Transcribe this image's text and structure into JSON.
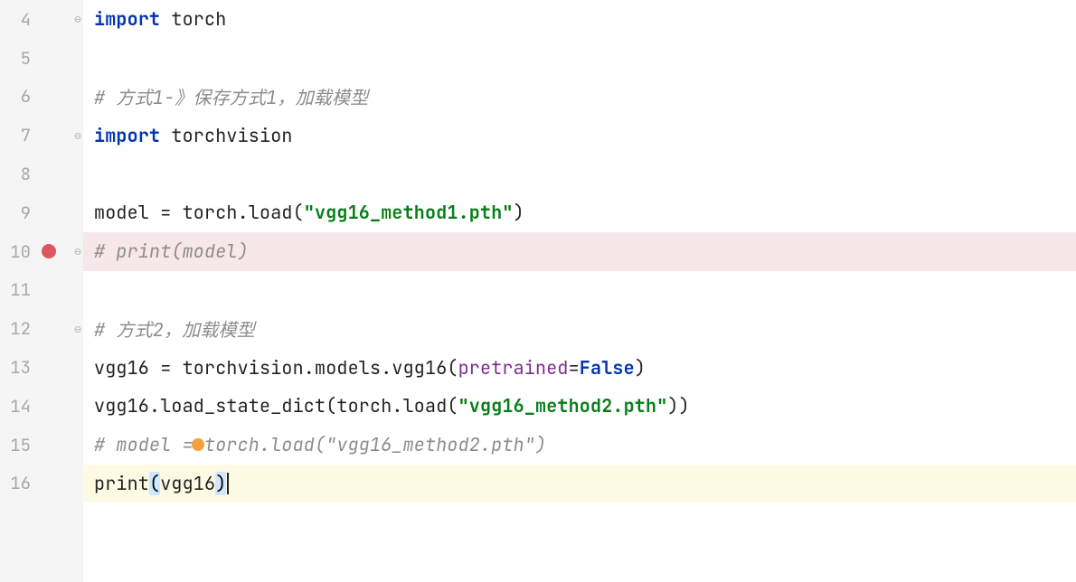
{
  "lines": [
    {
      "num": "4",
      "fold": "⊖",
      "bg": "",
      "tokens": [
        {
          "t": "import",
          "c": "kw"
        },
        {
          "t": " torch",
          "c": "id"
        }
      ]
    },
    {
      "num": "5",
      "fold": "",
      "bg": "",
      "tokens": []
    },
    {
      "num": "6",
      "fold": "",
      "bg": "",
      "tokens": [
        {
          "t": "# 方式1-》保存方式1，加载模型",
          "c": "comment"
        }
      ]
    },
    {
      "num": "7",
      "fold": "⊖",
      "bg": "",
      "tokens": [
        {
          "t": "import",
          "c": "kw"
        },
        {
          "t": " torchvision",
          "c": "id"
        }
      ]
    },
    {
      "num": "8",
      "fold": "",
      "bg": "",
      "tokens": []
    },
    {
      "num": "9",
      "fold": "",
      "bg": "",
      "tokens": [
        {
          "t": "model ",
          "c": "id"
        },
        {
          "t": "=",
          "c": "op"
        },
        {
          "t": " torch.load(",
          "c": "call"
        },
        {
          "t": "\"vgg16_method1.pth\"",
          "c": "str"
        },
        {
          "t": ")",
          "c": "call"
        }
      ]
    },
    {
      "num": "10",
      "fold": "⊖",
      "bg": "bg-break",
      "bp": true,
      "tokens": [
        {
          "t": "# print(model)",
          "c": "comment"
        }
      ]
    },
    {
      "num": "11",
      "fold": "",
      "bg": "",
      "tokens": []
    },
    {
      "num": "12",
      "fold": "⊖",
      "bg": "",
      "tokens": [
        {
          "t": "# 方式2，加载模型",
          "c": "comment"
        }
      ]
    },
    {
      "num": "13",
      "fold": "",
      "bg": "",
      "tokens": [
        {
          "t": "vgg16 ",
          "c": "id"
        },
        {
          "t": "=",
          "c": "op"
        },
        {
          "t": " torchvision.models.vgg16(",
          "c": "call"
        },
        {
          "t": "pretrained",
          "c": "kwarg"
        },
        {
          "t": "=",
          "c": "op"
        },
        {
          "t": "False",
          "c": "kw"
        },
        {
          "t": ")",
          "c": "call"
        }
      ]
    },
    {
      "num": "14",
      "fold": "",
      "bg": "",
      "tokens": [
        {
          "t": "vgg16.load_state_dict(torch.load(",
          "c": "call"
        },
        {
          "t": "\"vgg16_method2.pth\"",
          "c": "str"
        },
        {
          "t": "))",
          "c": "call"
        }
      ]
    },
    {
      "num": "15",
      "fold": "",
      "bg": "",
      "bulb": true,
      "tokens": [
        {
          "t": "# model = torch.load(\"vgg16_method2.pth\")",
          "c": "comment"
        }
      ]
    },
    {
      "num": "16",
      "fold": "",
      "bg": "bg-active",
      "tokens": [
        {
          "t": "print",
          "c": "call"
        },
        {
          "t": "(",
          "c": "paren-hl"
        },
        {
          "t": "vgg16",
          "c": "id"
        },
        {
          "t": ")",
          "c": "paren-hl"
        }
      ],
      "caret": true
    }
  ]
}
